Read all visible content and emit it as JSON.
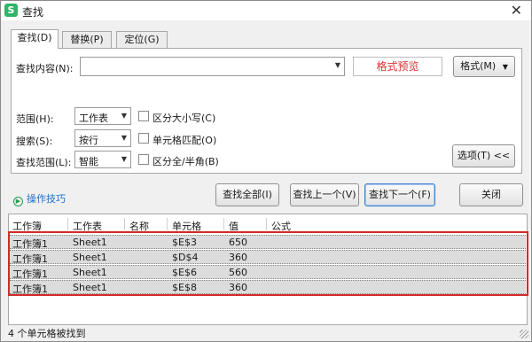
{
  "window": {
    "title": "查找",
    "app_icon": "S",
    "close_glyph": "✕"
  },
  "tabs": [
    {
      "label": "查找(D)",
      "active": true
    },
    {
      "label": "替换(P)",
      "active": false
    },
    {
      "label": "定位(G)",
      "active": false
    }
  ],
  "find": {
    "content_label": "查找内容(N):",
    "content_value": "",
    "format_preview": "格式预览",
    "format_button": "格式(M)",
    "scope_label": "范围(H):",
    "scope_value": "工作表",
    "search_label": "搜索(S):",
    "search_value": "按行",
    "lookin_label": "查找范围(L):",
    "lookin_value": "智能",
    "match_case": "区分大小写(C)",
    "match_cell": "单元格匹配(O)",
    "match_width": "区分全/半角(B)",
    "options_button": "选项(T) <<"
  },
  "actions": {
    "tips": "操作技巧",
    "find_all": "查找全部(I)",
    "find_prev": "查找上一个(V)",
    "find_next": "查找下一个(F)",
    "close": "关闭"
  },
  "results": {
    "columns": [
      "工作簿",
      "工作表",
      "名称",
      "单元格",
      "值",
      "公式"
    ],
    "rows": [
      {
        "book": "工作簿1",
        "sheet": "Sheet1",
        "name": "",
        "cell": "$E$3",
        "value": "650",
        "formula": ""
      },
      {
        "book": "工作簿1",
        "sheet": "Sheet1",
        "name": "",
        "cell": "$D$4",
        "value": "360",
        "formula": ""
      },
      {
        "book": "工作簿1",
        "sheet": "Sheet1",
        "name": "",
        "cell": "$E$6",
        "value": "560",
        "formula": ""
      },
      {
        "book": "工作簿1",
        "sheet": "Sheet1",
        "name": "",
        "cell": "$E$8",
        "value": "360",
        "formula": ""
      }
    ]
  },
  "status": "4 个单元格被找到",
  "colors": {
    "highlight_border": "#d42a2a",
    "format_preview_text": "#e03030",
    "tips_link": "#1a6fc8",
    "app_icon": "#2fb46a"
  }
}
